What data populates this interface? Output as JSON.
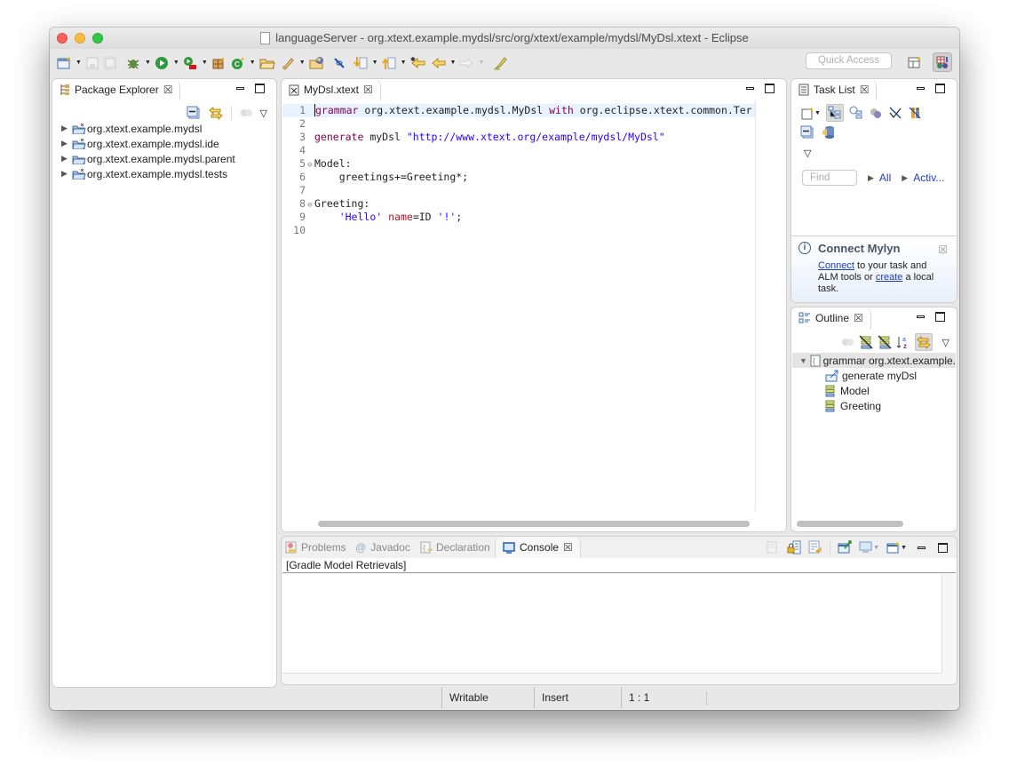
{
  "window": {
    "title": "languageServer - org.xtext.example.mydsl/src/org/xtext/example/mydsl/MyDsl.xtext - Eclipse"
  },
  "toolbar": {
    "icons": [
      "new-wizard-icon",
      "save-icon",
      "save-all-icon",
      "debug-icon",
      "run-icon",
      "external-tools-icon",
      "new-plugin-project-icon",
      "new-xtext-icon",
      "open-type-icon",
      "search-icon",
      "open-task-icon",
      "toggle-mark-occurrences-icon",
      "next-annotation-icon",
      "previous-annotation-icon",
      "last-edit-location-icon",
      "back-icon",
      "forward-icon",
      "pin-editor-icon"
    ],
    "quick_access_placeholder": "Quick Access"
  },
  "package_explorer": {
    "tab_label": "Package Explorer",
    "projects": [
      {
        "name": "org.xtext.example.mydsl"
      },
      {
        "name": "org.xtext.example.mydsl.ide"
      },
      {
        "name": "org.xtext.example.mydsl.parent"
      },
      {
        "name": "org.xtext.example.mydsl.tests"
      }
    ]
  },
  "editor": {
    "tab_label": "MyDsl.xtext",
    "lines": [
      {
        "n": "1",
        "parts": [
          {
            "t": "grammar",
            "c": "kw"
          },
          {
            "t": " org.xtext.example.mydsl.MyDsl ",
            "c": ""
          },
          {
            "t": "with",
            "c": "kw"
          },
          {
            "t": " org.eclipse.xtext.common.Ter",
            "c": ""
          }
        ]
      },
      {
        "n": "2",
        "parts": []
      },
      {
        "n": "3",
        "parts": [
          {
            "t": "generate",
            "c": "kw"
          },
          {
            "t": " myDsl ",
            "c": ""
          },
          {
            "t": "\"http://www.xtext.org/example/mydsl/MyDsl\"",
            "c": "str"
          }
        ]
      },
      {
        "n": "4",
        "parts": []
      },
      {
        "n": "5",
        "fold": true,
        "parts": [
          {
            "t": "Model:",
            "c": ""
          }
        ]
      },
      {
        "n": "6",
        "parts": [
          {
            "t": "    greetings+=Greeting*;",
            "c": ""
          }
        ]
      },
      {
        "n": "7",
        "parts": []
      },
      {
        "n": "8",
        "fold": true,
        "parts": [
          {
            "t": "Greeting:",
            "c": ""
          }
        ]
      },
      {
        "n": "9",
        "parts": [
          {
            "t": "    ",
            "c": ""
          },
          {
            "t": "'Hello'",
            "c": "str"
          },
          {
            "t": " ",
            "c": ""
          },
          {
            "t": "name",
            "c": "attr"
          },
          {
            "t": "=ID ",
            "c": ""
          },
          {
            "t": "'!'",
            "c": "str"
          },
          {
            "t": ";",
            "c": ""
          }
        ]
      },
      {
        "n": "10",
        "parts": []
      }
    ]
  },
  "task_list": {
    "tab_label": "Task List",
    "find_placeholder": "Find",
    "filter_all": "All",
    "filter_active": "Activ...",
    "mylyn": {
      "title": "Connect Mylyn",
      "connect_link": "Connect",
      "text1": " to your task and ALM tools or ",
      "create_link": "create",
      "text2": " a local task."
    }
  },
  "outline": {
    "tab_label": "Outline",
    "root": "grammar org.xtext.example.",
    "children": [
      "generate myDsl",
      "Model",
      "Greeting"
    ]
  },
  "bottom_panel": {
    "tabs": [
      {
        "label": "Problems",
        "active": false
      },
      {
        "label": "Javadoc",
        "active": false
      },
      {
        "label": "Declaration",
        "active": false
      },
      {
        "label": "Console",
        "active": true
      }
    ],
    "console_title": "[Gradle Model Retrievals]"
  },
  "statusbar": {
    "writable": "Writable",
    "insert_mode": "Insert",
    "position": "1 : 1"
  }
}
